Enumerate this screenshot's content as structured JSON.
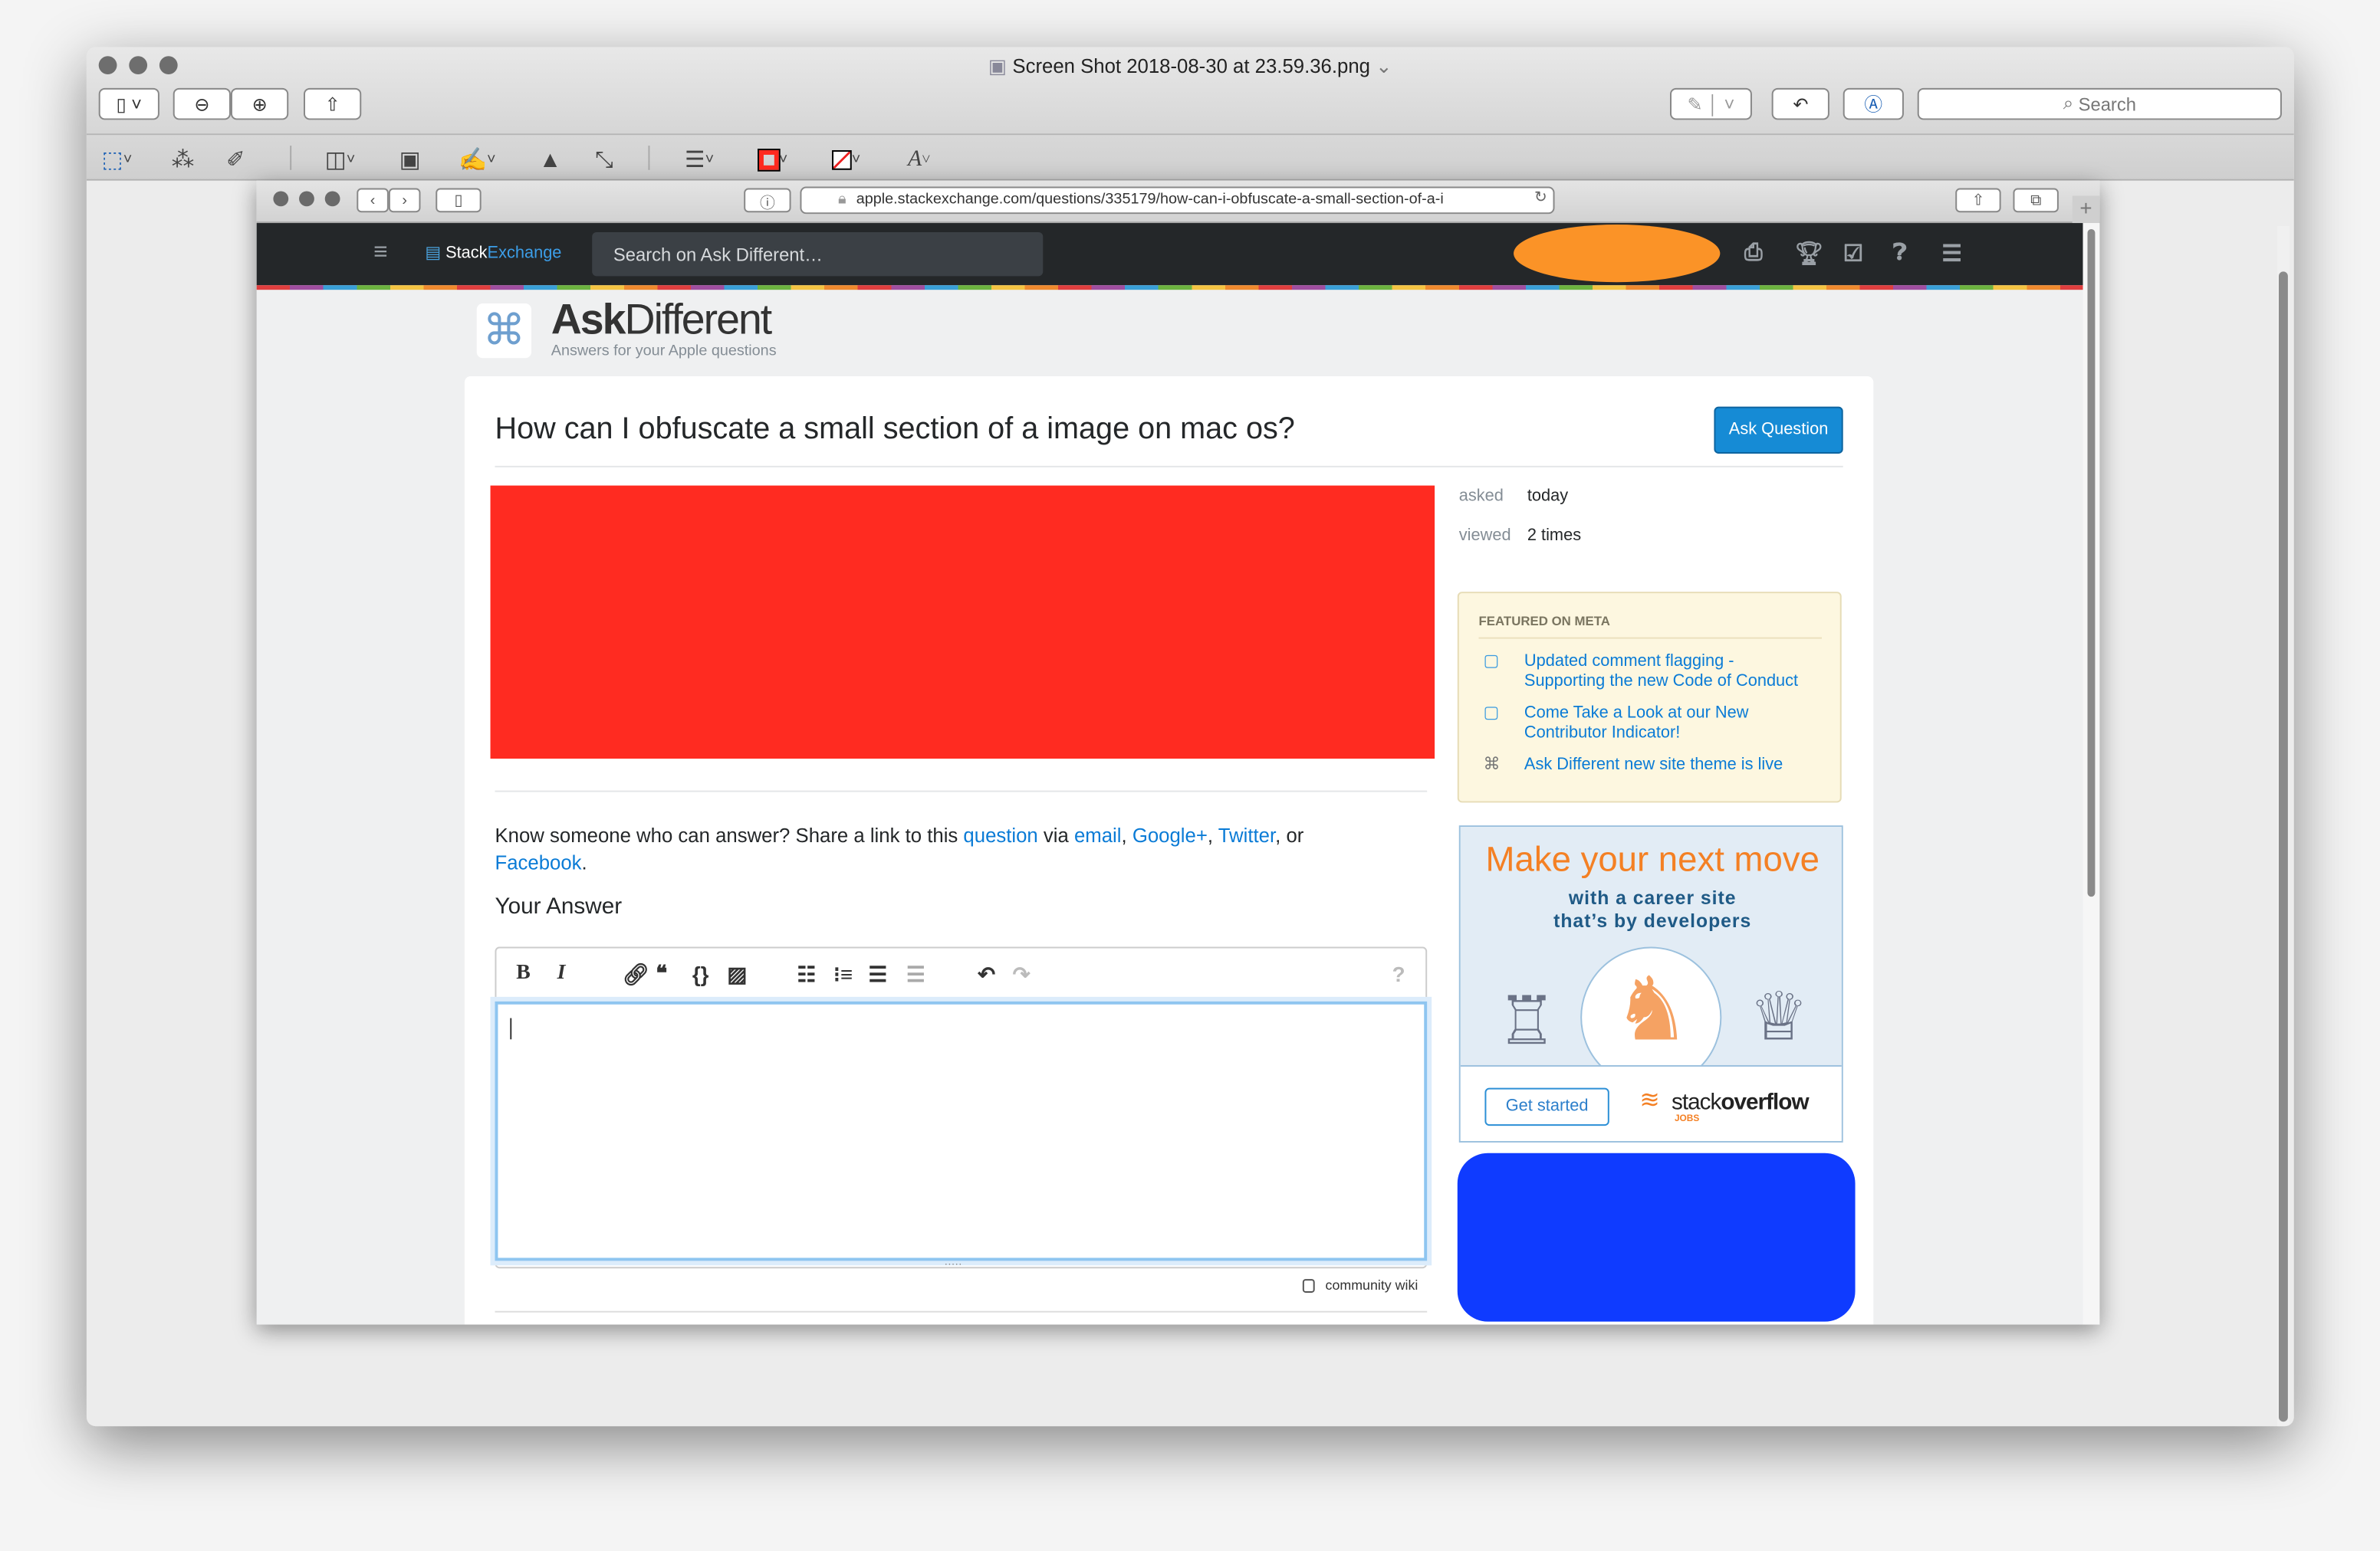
{
  "preview": {
    "window_title": "Screen Shot 2018-08-30 at 23.59.36.png",
    "search_placeholder": "Search",
    "icons": [
      "sidebar-icon",
      "zoom-out-icon",
      "zoom-in-icon",
      "share-icon",
      "highlight-icon",
      "rotate-icon",
      "markup-icon",
      "search-icon"
    ],
    "markup_icons": [
      "rect-select-icon",
      "instant-alpha-icon",
      "sketch-icon",
      "shapes-icon",
      "text-icon",
      "sign-icon",
      "adjust-color-icon",
      "adjust-size-icon",
      "shape-style-icon",
      "border-color-icon",
      "fill-color-icon",
      "text-style-icon"
    ],
    "border_color": "#ff2a1f"
  },
  "browser": {
    "url": "apple.stackexchange.com/questions/335179/how-can-i-obfuscate-a-small-section-of-a-i"
  },
  "site": {
    "brand_stack": "Stack",
    "brand_exchange": "Exchange",
    "search_placeholder": "Search on Ask Different…",
    "site_name_bold": "Ask",
    "site_name_light": "Different",
    "tagline": "Answers for your Apple questions",
    "accent": "#0a7bd6"
  },
  "question": {
    "title": "How can I obfuscate a small section of a image on mac os?",
    "ask_button": "Ask Question",
    "redaction_color": "#ff2b21"
  },
  "share": {
    "prefix": "Know someone who can answer? Share a link to this ",
    "question": "question",
    "via": " via ",
    "email": "email",
    "comma1": ", ",
    "google": "Google+",
    "comma2": ", ",
    "twitter": "Twitter",
    "or": ", or",
    "facebook": "Facebook",
    "period": "."
  },
  "answer": {
    "heading": "Your Answer",
    "community_wiki": "community wiki"
  },
  "meta": {
    "asked_label": "asked",
    "asked_value": "today",
    "viewed_label": "viewed",
    "viewed_value": "2 times"
  },
  "featured": {
    "heading": "FEATURED ON META",
    "items": [
      {
        "text": "Updated comment flagging - Supporting the new Code of Conduct"
      },
      {
        "text": "Come Take a Look at our New Contributor Indicator!"
      },
      {
        "text": "Ask Different new site theme is live"
      }
    ]
  },
  "ad": {
    "headline": "Make your next move",
    "sub1": "with a career site",
    "sub2": "that’s by developers",
    "cta": "Get started",
    "logo_stack": "stack",
    "logo_overflow": "overflow",
    "logo_jobs": "JOBS"
  },
  "redactions": {
    "user_color": "#fb9327",
    "sidebar_color": "#0f3bff"
  }
}
